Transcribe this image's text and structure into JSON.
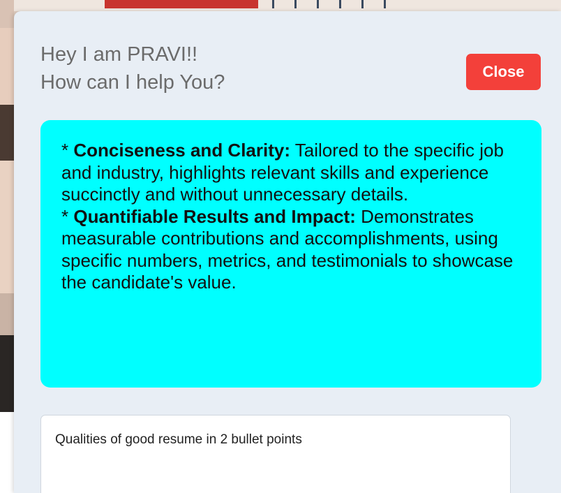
{
  "chat": {
    "greeting_line1": "Hey I am PRAVI!!",
    "greeting_line2": "How can I help You?",
    "close_label": "Close",
    "response": {
      "point1_prefix": "* ",
      "point1_title": "Conciseness and Clarity:",
      "point1_text": " Tailored to the specific job and industry, highlights relevant skills and experience succinctly and without unnecessary details.",
      "point2_prefix": "* ",
      "point2_title": "Quantifiable Results and Impact:",
      "point2_text": " Demonstrates measurable contributions and accomplishments, using specific numbers, metrics, and testimonials to showcase the candidate's value."
    },
    "prompt_value": "Qualities of good resume in 2 bullet points"
  },
  "colors": {
    "panel_bg": "#e8eef5",
    "close_button_bg": "#f3403a",
    "response_bg": "#00ffff",
    "greeting_text": "#6b6b6b"
  }
}
